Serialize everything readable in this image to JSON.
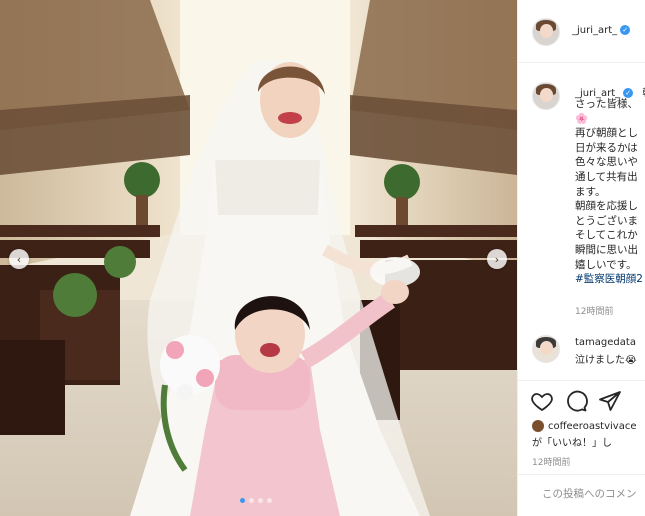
{
  "post": {
    "username": "_juri_art_",
    "verified": true,
    "caption_lines": [
      "朝",
      "さった皆様、",
      "🌸",
      "再び朝顔とし",
      "日が来るかは",
      "色々な思いや",
      "通して共有出",
      "ます。",
      "朝顔を応援し",
      "とうございま",
      "そしてこれか",
      "瞬間に思い出",
      "嬉しいです。"
    ],
    "hashtag": "#監察医朝顔2",
    "caption_time": "12時間前",
    "post_time": "12時間前"
  },
  "comment": {
    "username": "tamagedata",
    "text": "泣けました😭"
  },
  "likes": {
    "username": "coffeeroastvivace",
    "text": "が「いいね！」し"
  },
  "comment_input": {
    "placeholder": "この投稿へのコメン"
  },
  "carousel": {
    "prev_icon": "chevron-left-icon",
    "next_icon": "chevron-right-icon",
    "prev_glyph": "‹",
    "next_glyph": "›",
    "dot_count": 4,
    "active_index": 0
  },
  "colors": {
    "accent": "#3897f0",
    "text": "#262626",
    "muted": "#8e8e8e",
    "hashtag": "#00376b",
    "divider": "#efefef"
  }
}
